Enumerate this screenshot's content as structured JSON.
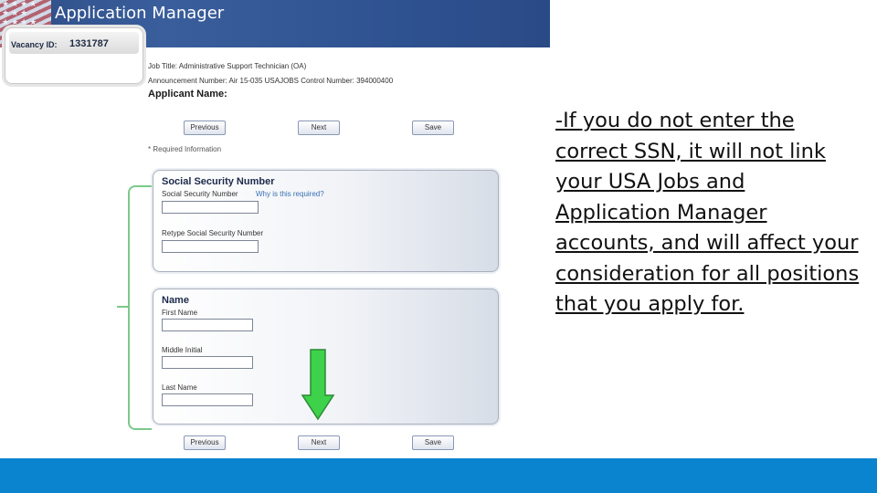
{
  "app": {
    "title": "Application Manager",
    "vacancy_label": "Vacancy ID:",
    "vacancy_id": "1331787"
  },
  "job": {
    "title_line": "Job Title: Administrative Support Technician (OA)",
    "announcement_line": "Announcement Number: Air 15-035    USAJOBS Control Number: 394000400",
    "applicant_label": "Applicant Name:"
  },
  "nav": {
    "previous": "Previous",
    "next": "Next",
    "save": "Save"
  },
  "required_note": "* Required Information",
  "ssn_section": {
    "title": "Social Security Number",
    "ssn_label": "Social Security Number",
    "why_link": "Why is this required?",
    "retype_label": "Retype Social Security Number",
    "ssn_value": "",
    "retype_value": ""
  },
  "name_section": {
    "title": "Name",
    "first_label": "First Name",
    "middle_label": "Middle Initial",
    "last_label": "Last Name",
    "first_value": "",
    "middle_value": "",
    "last_value": ""
  },
  "note": {
    "text": "-If you do not enter the correct SSN, it will not link your USA Jobs and Application Manager accounts, and will affect your consideration for all positions that you apply for."
  },
  "colors": {
    "header_blue": "#2f5291",
    "arrow_green": "#3ed24a",
    "bracket_green": "#7cc98a",
    "footer_blue": "#0b84d0"
  },
  "icons": {
    "pointer": "down-arrow-icon",
    "bracket": "bracket-icon"
  }
}
